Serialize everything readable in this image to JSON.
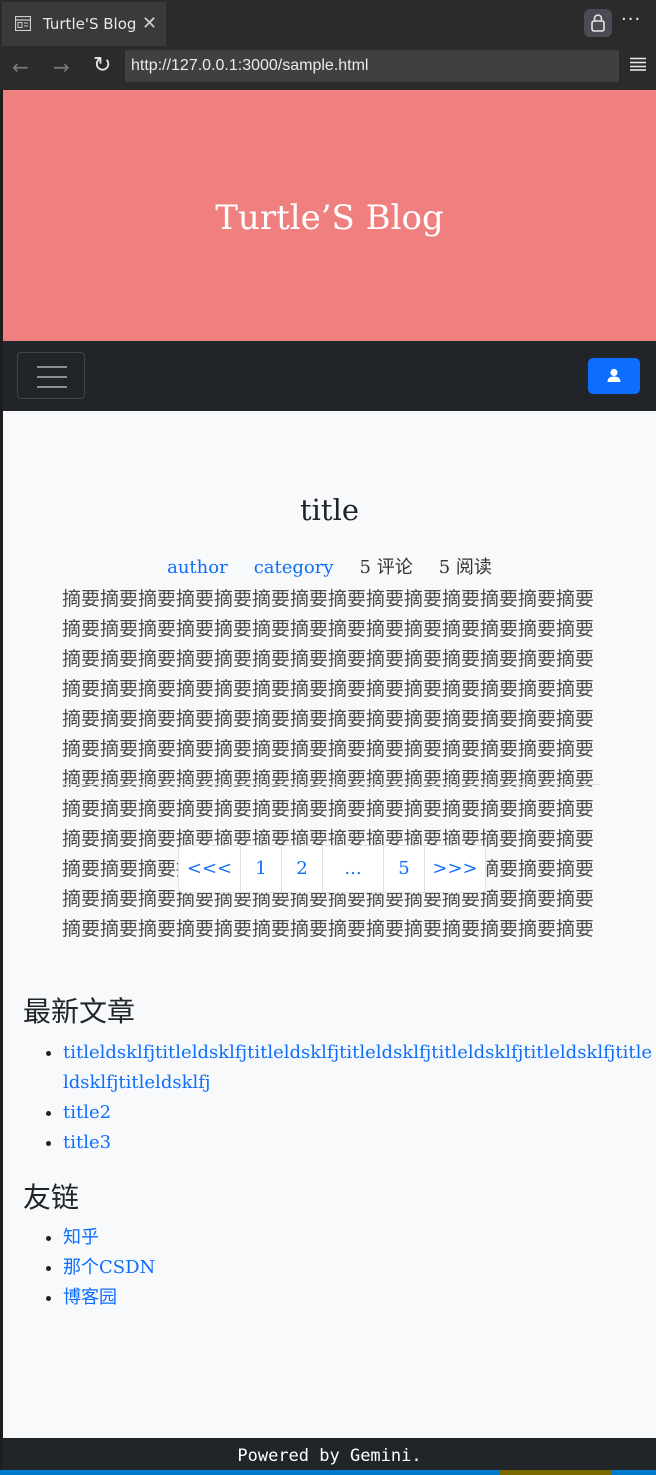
{
  "browser": {
    "tab_title": "Turtle'S Blog",
    "tab_close": "✕",
    "url": "http://127.0.0.1:3000/sample.html",
    "more": "···"
  },
  "hero": {
    "title": "Turtle’S Blog",
    "bg_color": "#f08080"
  },
  "post": {
    "title": "title",
    "author": "author",
    "category": "category",
    "comments": "5 评论",
    "reads": "5 阅读",
    "summary": "摘要摘要摘要摘要摘要摘要摘要摘要摘要摘要摘要摘要摘要摘要摘要摘要摘要摘要摘要摘要摘要摘要摘要摘要摘要摘要摘要摘要摘要摘要摘要摘要摘要摘要摘要摘要摘要摘要摘要摘要摘要摘要摘要摘要摘要摘要摘要摘要摘要摘要摘要摘要摘要摘要摘要摘要摘要摘要摘要摘要摘要摘要摘要摘要摘要摘要摘要摘要摘要摘要摘要摘要摘要摘要摘要摘要摘要摘要摘要摘要摘要摘要摘要摘要摘要摘要摘要摘要摘要摘要摘要摘要摘要摘要摘要摘要摘要摘要摘要摘要摘要摘要摘要摘要摘要摘要摘要摘要摘要摘要摘要摘要摘要摘要摘要摘要摘要摘要摘要摘要摘要摘要摘要摘要摘要摘要摘要摘要摘要摘要摘要摘要摘要摘要摘要摘要摘要摘要摘要摘要摘要摘要摘要摘要摘要摘要摘要摘要摘要摘要摘要摘要摘要摘要摘要摘要摘要摘要摘要摘要摘要摘要摘要摘要摘要摘要摘要摘要"
  },
  "pagination": {
    "prev": "<<<",
    "pages": [
      "1",
      "2",
      "...",
      "5"
    ],
    "next": ">>>"
  },
  "latest": {
    "heading": "最新文章",
    "items": [
      "titleldsklfjtitleldsklfjtitleldsklfjtitleldsklfjtitleldsklfjtitleldsklfjtitleldsklfjtitleldsklfj",
      "title2",
      "title3"
    ]
  },
  "friends": {
    "heading": "友链",
    "items": [
      "知乎",
      "那个CSDN",
      "博客园"
    ]
  },
  "footer": {
    "text": "Powered by Gemini."
  },
  "colors": {
    "accent": "#0d6efd",
    "navbar": "#212529"
  }
}
